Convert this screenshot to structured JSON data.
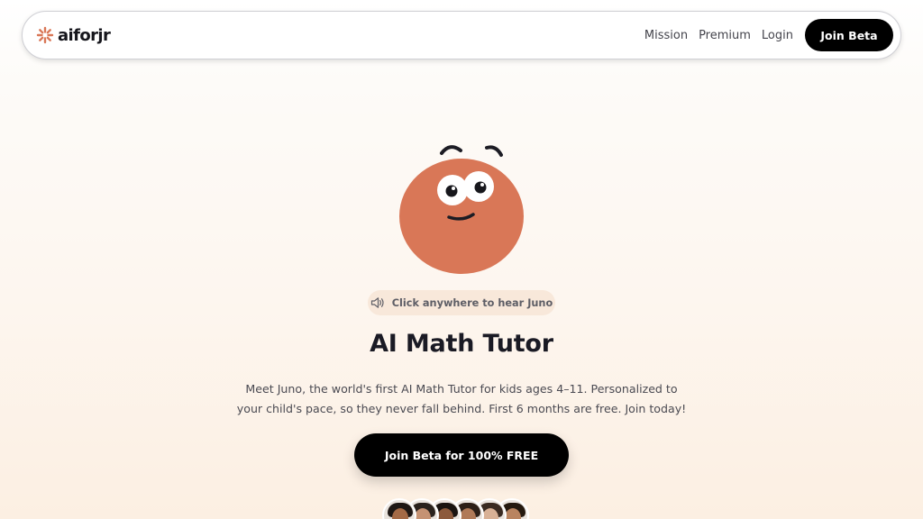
{
  "brand": {
    "name": "aiforjr",
    "logo_color": "#d97757"
  },
  "nav": {
    "links": [
      "Mission",
      "Premium",
      "Login"
    ],
    "cta": "Join Beta"
  },
  "hero": {
    "mascot_name": "Juno",
    "mascot_color": "#d97757",
    "audio_hint": "Click anywhere to hear Juno",
    "title": "AI Math Tutor",
    "subtitle_line1": "Meet Juno, the world's first AI Math Tutor for kids ages 4–11. Personalized to",
    "subtitle_line2": "your child's pace, so they never fall behind. First 6 months are free. Join today!",
    "cta": "Join Beta for 100% FREE"
  },
  "icons": {
    "logo": "sparkle-icon",
    "audio": "speaker-icon"
  },
  "avatars": [
    {
      "skin": "#a46a46",
      "hair": "#1e1714"
    },
    {
      "skin": "#c59273",
      "hair": "#2a221d"
    },
    {
      "skin": "#8c5a3c",
      "hair": "#1a1411"
    },
    {
      "skin": "#b07a58",
      "hair": "#2c1f17"
    },
    {
      "skin": "#d8b196",
      "hair": "#3a2b22"
    },
    {
      "skin": "#b98460",
      "hair": "#24190f"
    }
  ]
}
